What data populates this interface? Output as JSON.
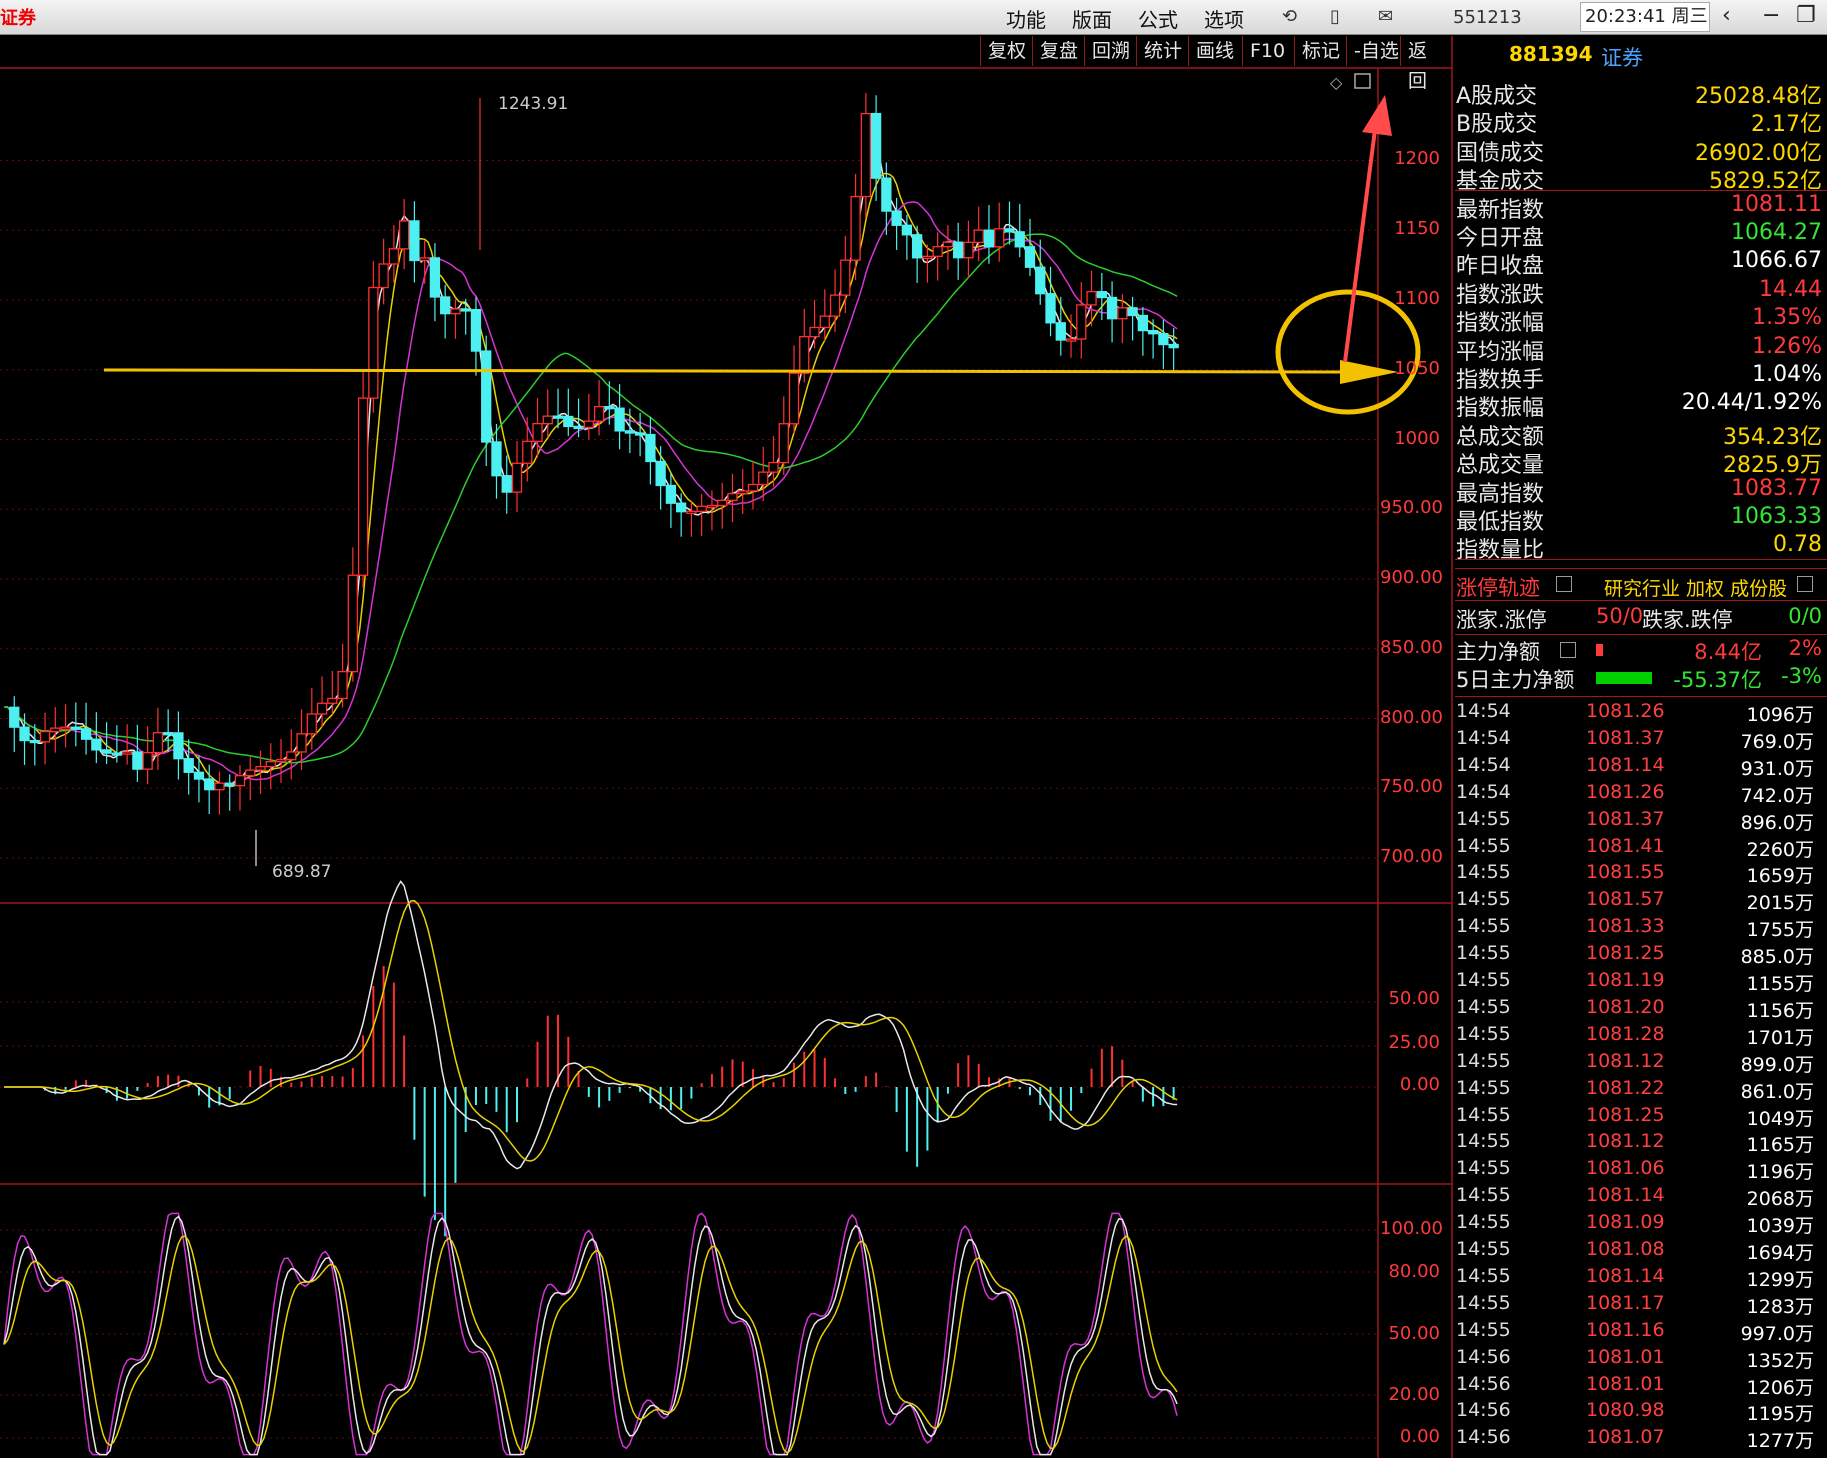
{
  "app": {
    "title": "证券"
  },
  "menu": [
    "功能",
    "版面",
    "公式",
    "选项"
  ],
  "toolbar": {
    "code_input": "551213",
    "clock": "20:23:41 周三"
  },
  "chart_toolbar": [
    "复权",
    "复盘",
    "回溯",
    "统计",
    "画线",
    "F10",
    "标记",
    "-自选",
    "返回"
  ],
  "index": {
    "code": "881394",
    "name": "证券"
  },
  "stats": [
    {
      "label": "A股成交",
      "value": "25028.48亿",
      "color": "#ffd700"
    },
    {
      "label": "B股成交",
      "value": "2.17亿",
      "color": "#ffd700"
    },
    {
      "label": "国债成交",
      "value": "26902.00亿",
      "color": "#ffd700"
    },
    {
      "label": "基金成交",
      "value": "5829.52亿",
      "color": "#ffd700"
    },
    {
      "label": "最新指数",
      "value": "1081.11",
      "color": "#ff3a3a"
    },
    {
      "label": "今日开盘",
      "value": "1064.27",
      "color": "#33e633"
    },
    {
      "label": "昨日收盘",
      "value": "1066.67",
      "color": "#ffffff"
    },
    {
      "label": "指数涨跌",
      "value": "14.44",
      "color": "#ff3a3a"
    },
    {
      "label": "指数涨幅",
      "value": "1.35%",
      "color": "#ff3a3a"
    },
    {
      "label": "平均涨幅",
      "value": "1.26%",
      "color": "#ff3a3a"
    },
    {
      "label": "指数换手",
      "value": "1.04%",
      "color": "#ffffff"
    },
    {
      "label": "指数振幅",
      "value": "20.44/1.92%",
      "color": "#ffffff"
    },
    {
      "label": "总成交额",
      "value": "354.23亿",
      "color": "#ffd700"
    },
    {
      "label": "总成交量",
      "value": "2825.9万",
      "color": "#ffd700"
    },
    {
      "label": "最高指数",
      "value": "1083.77",
      "color": "#ff3a3a"
    },
    {
      "label": "最低指数",
      "value": "1063.33",
      "color": "#33e633"
    },
    {
      "label": "指数量比",
      "value": "0.78",
      "color": "#ffd700"
    }
  ],
  "limit_section": {
    "title": "涨停轨迹",
    "links": "研究行业 加权 成份股"
  },
  "limit_row": {
    "label": "涨家.涨停",
    "value": "50/0",
    "label2": "跌家.跌停",
    "value2": "0/0"
  },
  "flow": [
    {
      "label": "主力净额",
      "value": "8.44亿",
      "pct": "2%",
      "color": "#ff3a3a"
    },
    {
      "label": "5日主力净额",
      "value": "-55.37亿",
      "pct": "-3%",
      "color": "#33e633"
    }
  ],
  "ticks": [
    [
      "14:54",
      "1081.26",
      "1096万"
    ],
    [
      "14:54",
      "1081.37",
      "769.0万"
    ],
    [
      "14:54",
      "1081.14",
      "931.0万"
    ],
    [
      "14:54",
      "1081.26",
      "742.0万"
    ],
    [
      "14:55",
      "1081.37",
      "896.0万"
    ],
    [
      "14:55",
      "1081.41",
      "2260万"
    ],
    [
      "14:55",
      "1081.55",
      "1659万"
    ],
    [
      "14:55",
      "1081.57",
      "2015万"
    ],
    [
      "14:55",
      "1081.33",
      "1755万"
    ],
    [
      "14:55",
      "1081.25",
      "885.0万"
    ],
    [
      "14:55",
      "1081.19",
      "1155万"
    ],
    [
      "14:55",
      "1081.20",
      "1156万"
    ],
    [
      "14:55",
      "1081.28",
      "1701万"
    ],
    [
      "14:55",
      "1081.12",
      "899.0万"
    ],
    [
      "14:55",
      "1081.22",
      "861.0万"
    ],
    [
      "14:55",
      "1081.25",
      "1049万"
    ],
    [
      "14:55",
      "1081.12",
      "1165万"
    ],
    [
      "14:55",
      "1081.06",
      "1196万"
    ],
    [
      "14:55",
      "1081.14",
      "2068万"
    ],
    [
      "14:55",
      "1081.09",
      "1039万"
    ],
    [
      "14:55",
      "1081.08",
      "1694万"
    ],
    [
      "14:55",
      "1081.14",
      "1299万"
    ],
    [
      "14:55",
      "1081.17",
      "1283万"
    ],
    [
      "14:55",
      "1081.16",
      "997.0万"
    ],
    [
      "14:56",
      "1081.01",
      "1352万"
    ],
    [
      "14:56",
      "1081.01",
      "1206万"
    ],
    [
      "14:56",
      "1080.98",
      "1195万"
    ],
    [
      "14:56",
      "1081.07",
      "1277万"
    ]
  ],
  "main_axis": [
    "1200",
    "1150",
    "1100",
    "1050",
    "1000",
    "950.00",
    "900.00",
    "850.00",
    "800.00",
    "750.00",
    "700.00"
  ],
  "annotations": {
    "high": "1243.91",
    "low": "689.87"
  },
  "macd_axis": [
    "50.00",
    "25.00",
    "0.00"
  ],
  "kdj_axis": [
    "100.00",
    "80.00",
    "50.00",
    "20.00",
    "0.00"
  ]
}
